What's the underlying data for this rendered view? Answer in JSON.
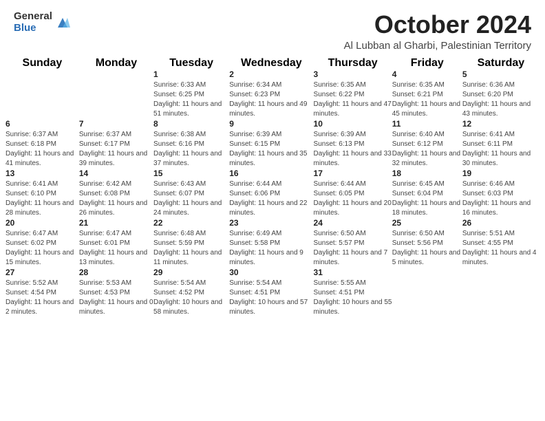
{
  "header": {
    "logo_general": "General",
    "logo_blue": "Blue",
    "month_year": "October 2024",
    "location": "Al Lubban al Gharbi, Palestinian Territory"
  },
  "weekdays": [
    "Sunday",
    "Monday",
    "Tuesday",
    "Wednesday",
    "Thursday",
    "Friday",
    "Saturday"
  ],
  "weeks": [
    [
      {
        "day": "",
        "sunrise": "",
        "sunset": "",
        "daylight": ""
      },
      {
        "day": "",
        "sunrise": "",
        "sunset": "",
        "daylight": ""
      },
      {
        "day": "1",
        "sunrise": "Sunrise: 6:33 AM",
        "sunset": "Sunset: 6:25 PM",
        "daylight": "Daylight: 11 hours and 51 minutes."
      },
      {
        "day": "2",
        "sunrise": "Sunrise: 6:34 AM",
        "sunset": "Sunset: 6:23 PM",
        "daylight": "Daylight: 11 hours and 49 minutes."
      },
      {
        "day": "3",
        "sunrise": "Sunrise: 6:35 AM",
        "sunset": "Sunset: 6:22 PM",
        "daylight": "Daylight: 11 hours and 47 minutes."
      },
      {
        "day": "4",
        "sunrise": "Sunrise: 6:35 AM",
        "sunset": "Sunset: 6:21 PM",
        "daylight": "Daylight: 11 hours and 45 minutes."
      },
      {
        "day": "5",
        "sunrise": "Sunrise: 6:36 AM",
        "sunset": "Sunset: 6:20 PM",
        "daylight": "Daylight: 11 hours and 43 minutes."
      }
    ],
    [
      {
        "day": "6",
        "sunrise": "Sunrise: 6:37 AM",
        "sunset": "Sunset: 6:18 PM",
        "daylight": "Daylight: 11 hours and 41 minutes."
      },
      {
        "day": "7",
        "sunrise": "Sunrise: 6:37 AM",
        "sunset": "Sunset: 6:17 PM",
        "daylight": "Daylight: 11 hours and 39 minutes."
      },
      {
        "day": "8",
        "sunrise": "Sunrise: 6:38 AM",
        "sunset": "Sunset: 6:16 PM",
        "daylight": "Daylight: 11 hours and 37 minutes."
      },
      {
        "day": "9",
        "sunrise": "Sunrise: 6:39 AM",
        "sunset": "Sunset: 6:15 PM",
        "daylight": "Daylight: 11 hours and 35 minutes."
      },
      {
        "day": "10",
        "sunrise": "Sunrise: 6:39 AM",
        "sunset": "Sunset: 6:13 PM",
        "daylight": "Daylight: 11 hours and 33 minutes."
      },
      {
        "day": "11",
        "sunrise": "Sunrise: 6:40 AM",
        "sunset": "Sunset: 6:12 PM",
        "daylight": "Daylight: 11 hours and 32 minutes."
      },
      {
        "day": "12",
        "sunrise": "Sunrise: 6:41 AM",
        "sunset": "Sunset: 6:11 PM",
        "daylight": "Daylight: 11 hours and 30 minutes."
      }
    ],
    [
      {
        "day": "13",
        "sunrise": "Sunrise: 6:41 AM",
        "sunset": "Sunset: 6:10 PM",
        "daylight": "Daylight: 11 hours and 28 minutes."
      },
      {
        "day": "14",
        "sunrise": "Sunrise: 6:42 AM",
        "sunset": "Sunset: 6:08 PM",
        "daylight": "Daylight: 11 hours and 26 minutes."
      },
      {
        "day": "15",
        "sunrise": "Sunrise: 6:43 AM",
        "sunset": "Sunset: 6:07 PM",
        "daylight": "Daylight: 11 hours and 24 minutes."
      },
      {
        "day": "16",
        "sunrise": "Sunrise: 6:44 AM",
        "sunset": "Sunset: 6:06 PM",
        "daylight": "Daylight: 11 hours and 22 minutes."
      },
      {
        "day": "17",
        "sunrise": "Sunrise: 6:44 AM",
        "sunset": "Sunset: 6:05 PM",
        "daylight": "Daylight: 11 hours and 20 minutes."
      },
      {
        "day": "18",
        "sunrise": "Sunrise: 6:45 AM",
        "sunset": "Sunset: 6:04 PM",
        "daylight": "Daylight: 11 hours and 18 minutes."
      },
      {
        "day": "19",
        "sunrise": "Sunrise: 6:46 AM",
        "sunset": "Sunset: 6:03 PM",
        "daylight": "Daylight: 11 hours and 16 minutes."
      }
    ],
    [
      {
        "day": "20",
        "sunrise": "Sunrise: 6:47 AM",
        "sunset": "Sunset: 6:02 PM",
        "daylight": "Daylight: 11 hours and 15 minutes."
      },
      {
        "day": "21",
        "sunrise": "Sunrise: 6:47 AM",
        "sunset": "Sunset: 6:01 PM",
        "daylight": "Daylight: 11 hours and 13 minutes."
      },
      {
        "day": "22",
        "sunrise": "Sunrise: 6:48 AM",
        "sunset": "Sunset: 5:59 PM",
        "daylight": "Daylight: 11 hours and 11 minutes."
      },
      {
        "day": "23",
        "sunrise": "Sunrise: 6:49 AM",
        "sunset": "Sunset: 5:58 PM",
        "daylight": "Daylight: 11 hours and 9 minutes."
      },
      {
        "day": "24",
        "sunrise": "Sunrise: 6:50 AM",
        "sunset": "Sunset: 5:57 PM",
        "daylight": "Daylight: 11 hours and 7 minutes."
      },
      {
        "day": "25",
        "sunrise": "Sunrise: 6:50 AM",
        "sunset": "Sunset: 5:56 PM",
        "daylight": "Daylight: 11 hours and 5 minutes."
      },
      {
        "day": "26",
        "sunrise": "Sunrise: 5:51 AM",
        "sunset": "Sunset: 4:55 PM",
        "daylight": "Daylight: 11 hours and 4 minutes."
      }
    ],
    [
      {
        "day": "27",
        "sunrise": "Sunrise: 5:52 AM",
        "sunset": "Sunset: 4:54 PM",
        "daylight": "Daylight: 11 hours and 2 minutes."
      },
      {
        "day": "28",
        "sunrise": "Sunrise: 5:53 AM",
        "sunset": "Sunset: 4:53 PM",
        "daylight": "Daylight: 11 hours and 0 minutes."
      },
      {
        "day": "29",
        "sunrise": "Sunrise: 5:54 AM",
        "sunset": "Sunset: 4:52 PM",
        "daylight": "Daylight: 10 hours and 58 minutes."
      },
      {
        "day": "30",
        "sunrise": "Sunrise: 5:54 AM",
        "sunset": "Sunset: 4:51 PM",
        "daylight": "Daylight: 10 hours and 57 minutes."
      },
      {
        "day": "31",
        "sunrise": "Sunrise: 5:55 AM",
        "sunset": "Sunset: 4:51 PM",
        "daylight": "Daylight: 10 hours and 55 minutes."
      },
      {
        "day": "",
        "sunrise": "",
        "sunset": "",
        "daylight": ""
      },
      {
        "day": "",
        "sunrise": "",
        "sunset": "",
        "daylight": ""
      }
    ]
  ]
}
